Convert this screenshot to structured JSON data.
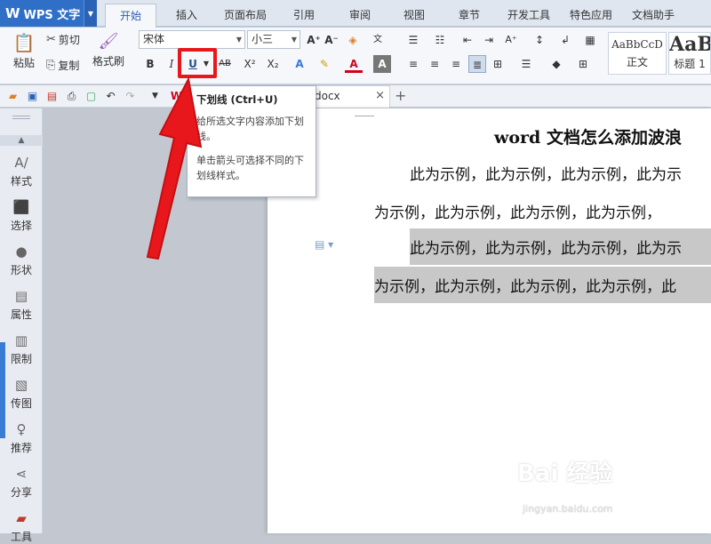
{
  "app": {
    "name": "WPS 文字",
    "logo": "W"
  },
  "tabs": [
    {
      "label": "开始",
      "active": true
    },
    {
      "label": "插入"
    },
    {
      "label": "页面布局"
    },
    {
      "label": "引用"
    },
    {
      "label": "审阅"
    },
    {
      "label": "视图"
    },
    {
      "label": "章节"
    },
    {
      "label": "开发工具"
    },
    {
      "label": "特色应用"
    },
    {
      "label": "文档助手"
    }
  ],
  "ribbon": {
    "paste": "粘贴",
    "cut": "剪切",
    "copy": "复制",
    "format_painter": "格式刷",
    "font_name": "宋体",
    "font_size": "小三",
    "bold": "B",
    "italic": "I",
    "underline": "U",
    "strike": "AB",
    "superscript": "X²",
    "subscript": "X₂",
    "font_color": "A",
    "styles": [
      {
        "preview": "AaBbCcD",
        "label": "正文"
      },
      {
        "preview": "AaB",
        "label": "标题 1"
      }
    ]
  },
  "doc_tab": {
    "name": "docx"
  },
  "tooltip": {
    "title": "下划线 (Ctrl+U)",
    "desc1": "给所选文字内容添加下划线。",
    "desc2": "单击箭头可选择不同的下划线样式。"
  },
  "sidebar": [
    {
      "label": "样式",
      "icon": "style-icon"
    },
    {
      "label": "选择",
      "icon": "select-icon"
    },
    {
      "label": "形状",
      "icon": "shape-icon"
    },
    {
      "label": "属性",
      "icon": "property-icon"
    },
    {
      "label": "限制",
      "icon": "restrict-icon"
    },
    {
      "label": "传图",
      "icon": "upload-image-icon"
    },
    {
      "label": "推荐",
      "icon": "recommend-icon"
    },
    {
      "label": "分享",
      "icon": "share-icon"
    },
    {
      "label": "工具",
      "icon": "tool-icon"
    }
  ],
  "document": {
    "title": "word 文档怎么添加波浪",
    "para1_line1": "此为示例，此为示例，此为示例，此为示",
    "para1_line2": "为示例，此为示例，此为示例，此为示例，",
    "para2_line1": "此为示例，此为示例，此为示例，此为示",
    "para2_line2": "为示例，此为示例，此为示例，此为示例，此"
  },
  "watermark": {
    "brand": "Bai 经验",
    "url": "jingyan.baidu.com"
  },
  "colors": {
    "accent": "#2f6fc7",
    "highlight": "#e8171b"
  }
}
